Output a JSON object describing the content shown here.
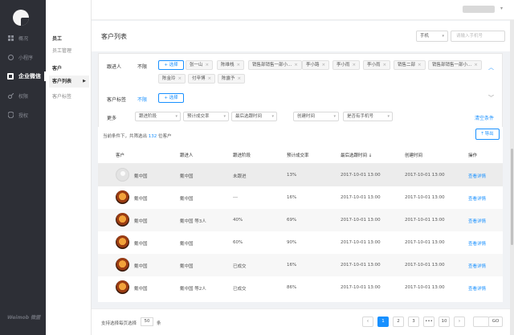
{
  "nav": {
    "items": [
      {
        "label": "概况",
        "icon": "dashboard-icon"
      },
      {
        "label": "小程序",
        "icon": "miniprogram-icon"
      },
      {
        "label": "企业微信",
        "icon": "wecom-icon"
      },
      {
        "label": "权限",
        "icon": "key-icon"
      },
      {
        "label": "授权",
        "icon": "shield-icon"
      }
    ],
    "brand": "Weimob 微盟"
  },
  "subnav": {
    "group1": "员工",
    "group1_items": [
      "员工管理"
    ],
    "group2": "客户",
    "group2_items": [
      "客户列表",
      "客户标签"
    ]
  },
  "header": {
    "title": "客户列表",
    "search_type": "手机",
    "search_placeholder": "请输入手机号"
  },
  "filters": {
    "follower_label": "跟进人",
    "any_label": "不限",
    "select_label": "+ 选择",
    "follower_tags": [
      "张一山",
      "陈维栈",
      "销售部销售一部小...",
      "李小路",
      "李小雨",
      "李小雨",
      "销售二部",
      "销售部销售一部小...",
      "陈金玲",
      "付辛博",
      "陈露予"
    ],
    "tag_label": "客户标签",
    "tag_any": "不限",
    "more_label": "更多",
    "dropdowns": [
      "跟进阶段",
      "预计成交率",
      "最后选跟时间",
      "创建时间",
      "是否有手机号"
    ],
    "clear_label": "清空条件"
  },
  "table": {
    "count_prefix": "当前条件下，共筛选出",
    "count_value": "132",
    "count_suffix": "位客户",
    "export_label": "导出",
    "columns": [
      "客户",
      "跟进人",
      "跟进阶段",
      "预计成交率",
      "最后选跟时间 ↓",
      "创建时间",
      "操作"
    ],
    "rows": [
      {
        "customer": "戴中国",
        "follower": "戴中国",
        "stage": "未跟进",
        "rate": "13%",
        "last": "2017-10-01 13:00",
        "created": "2017-10-01 13:00",
        "action": "查看详情"
      },
      {
        "customer": "戴中国",
        "follower": "戴中国",
        "stage": "---",
        "rate": "16%",
        "last": "2017-10-01 13:00",
        "created": "2017-10-01 13:00",
        "action": "查看详情"
      },
      {
        "customer": "戴中国",
        "follower": "戴中国 等3人",
        "stage": "40%",
        "rate": "69%",
        "last": "2017-10-01 13:00",
        "created": "2017-10-01 13:00",
        "action": "查看详情"
      },
      {
        "customer": "戴中国",
        "follower": "戴中国",
        "stage": "60%",
        "rate": "90%",
        "last": "2017-10-01 13:00",
        "created": "2017-10-01 13:00",
        "action": "查看详情"
      },
      {
        "customer": "戴中国",
        "follower": "戴中国",
        "stage": "已成交",
        "rate": "16%",
        "last": "2017-10-01 13:00",
        "created": "2017-10-01 13:00",
        "action": "查看详情"
      },
      {
        "customer": "戴中国",
        "follower": "戴中国 等2人",
        "stage": "已成交",
        "rate": "86%",
        "last": "2017-10-01 13:00",
        "created": "2017-10-01 13:00",
        "action": "查看详情"
      }
    ]
  },
  "footer": {
    "page_size_label": "支持选择每页选择",
    "page_size": "50",
    "page_size_unit": "条",
    "pages": [
      "‹",
      "1",
      "2",
      "3",
      "•••",
      "10",
      "›"
    ],
    "current_page": "1",
    "go_label": "GO"
  },
  "colors": {
    "accent": "#1890ff",
    "nav_bg": "#2d2f36"
  }
}
